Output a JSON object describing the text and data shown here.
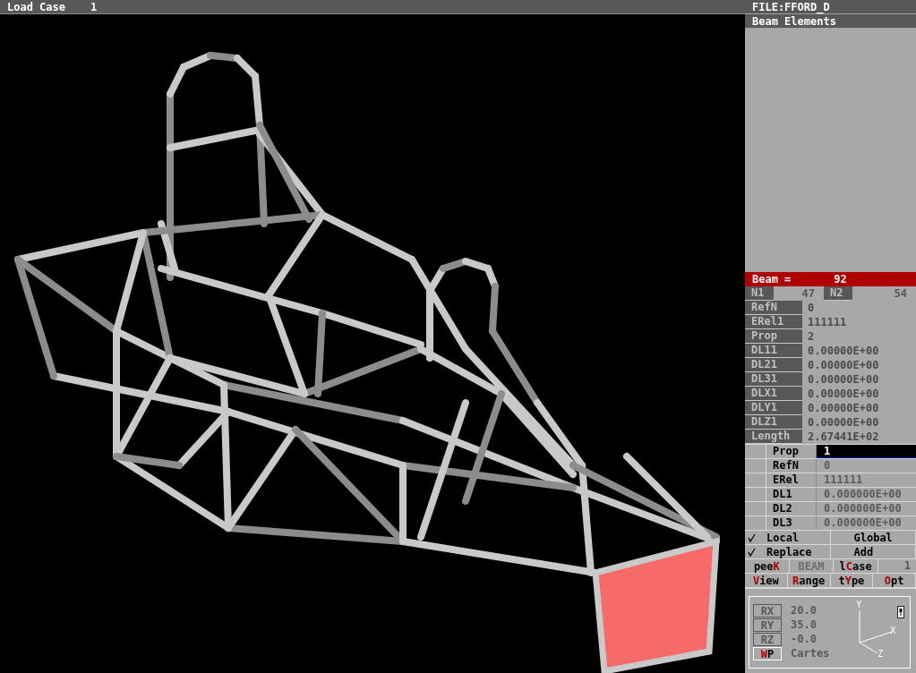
{
  "viewport": {
    "title": "Load Case",
    "load_case": "1"
  },
  "panel": {
    "file": "FILE:FFORD_D",
    "mode": "Beam Elements",
    "beam": {
      "label": "Beam =",
      "value": "92"
    },
    "nodes": [
      {
        "label": "N1",
        "value": "47"
      },
      {
        "label": "N2",
        "value": "54"
      }
    ],
    "fields": [
      {
        "label": "RefN",
        "value": "0"
      },
      {
        "label": "ERel1",
        "value": "111111"
      },
      {
        "label": "Prop",
        "value": "2"
      },
      {
        "label": "DL11",
        "value": "0.00000E+00"
      },
      {
        "label": "DL21",
        "value": "0.00000E+00"
      },
      {
        "label": "DL31",
        "value": "0.00000E+00"
      },
      {
        "label": "DLX1",
        "value": "0.00000E+00"
      },
      {
        "label": "DLY1",
        "value": "0.00000E+00"
      },
      {
        "label": "DLZ1",
        "value": "0.00000E+00"
      },
      {
        "label": "Length",
        "value": "2.67441E+02"
      }
    ],
    "edit_fields": [
      {
        "label": "Prop",
        "value": "1",
        "selected": true
      },
      {
        "label": "RefN",
        "value": "0",
        "selected": false
      },
      {
        "label": "ERel",
        "value": "111111",
        "selected": false
      },
      {
        "label": "DL1",
        "value": "0.000000E+00",
        "selected": false
      },
      {
        "label": "DL2",
        "value": "0.000000E+00",
        "selected": false
      },
      {
        "label": "DL3",
        "value": "0.000000E+00",
        "selected": false
      }
    ],
    "options": [
      [
        {
          "label": "Local",
          "checked": true
        },
        {
          "label": "Global",
          "checked": false
        }
      ],
      [
        {
          "label": "Replace",
          "checked": true
        },
        {
          "label": "Add",
          "checked": false
        }
      ]
    ],
    "commands": [
      [
        {
          "kind": "hotkey",
          "before": "pee",
          "key": "K"
        },
        {
          "kind": "plain",
          "label": "BEAM",
          "disabled": true
        },
        {
          "kind": "hotkey",
          "before": "l",
          "key": "C",
          "after": "ase"
        },
        {
          "kind": "value",
          "label": "1"
        }
      ],
      [
        {
          "kind": "hotkey",
          "key": "V",
          "after": "iew"
        },
        {
          "kind": "hotkey",
          "key": "R",
          "after": "ange"
        },
        {
          "kind": "hotkey",
          "before": "t",
          "key": "Y",
          "after": "pe"
        },
        {
          "kind": "hotkey",
          "key": "O",
          "after": "pt"
        }
      ]
    ],
    "view": {
      "rotations": [
        {
          "label": "RX",
          "value": "20.0"
        },
        {
          "label": "RY",
          "value": "35.0"
        },
        {
          "label": "RZ",
          "value": "-0.0"
        }
      ],
      "wp": {
        "key": "W",
        "after": "P"
      },
      "coord": "Cartes",
      "axes": {
        "y": "Y",
        "x": "X",
        "z": "Z"
      }
    }
  }
}
